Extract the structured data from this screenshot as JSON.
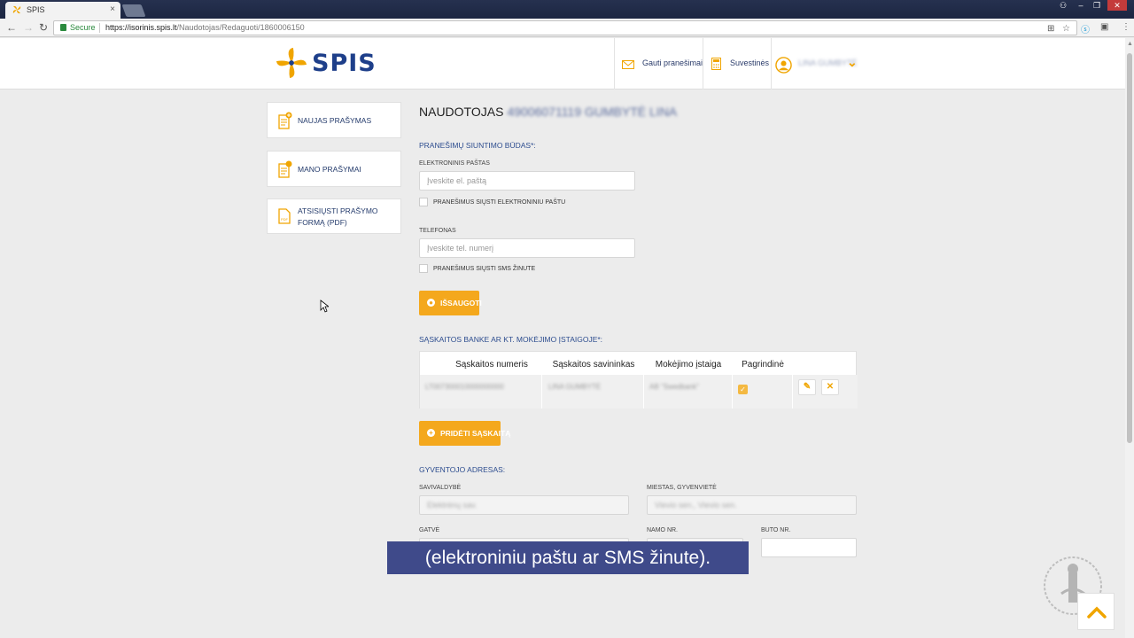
{
  "browser": {
    "tab_title": "SPIS",
    "tab_close": "×",
    "secure_label": "Secure",
    "url_host": "https://isorinis.spis.lt",
    "url_path": "/Naudotojas/Redaguoti/1860006150"
  },
  "header": {
    "logo_text": "SPIS",
    "notifications_label": "Gauti pranešimai",
    "summaries_label": "Suvestinės",
    "user_name": "LINA GUMBYTĖ"
  },
  "sidebar": {
    "items": [
      {
        "label": "NAUJAS PRAŠYMAS"
      },
      {
        "label": "MANO PRAŠYMAI"
      },
      {
        "label_line1": "ATSISIŲSTI PRAŠYMO",
        "label_line2": "FORMĄ (PDF)"
      }
    ]
  },
  "main": {
    "title": "NAUDOTOJAS",
    "title_user": "49006071119 GUMBYTĖ LINA",
    "notify_section": "PRANEŠIMŲ SIUNTIMO BŪDAS",
    "notify_section_suffix": "*:",
    "email_label": "ELEKTRONINIS PAŠTAS",
    "email_placeholder": "Įveskite el. paštą",
    "email_checkbox_label": "PRANEŠIMUS SIŲSTI ELEKTRONINIU PAŠTU",
    "phone_label": "TELEFONAS",
    "phone_placeholder": "Įveskite tel. numerį",
    "sms_checkbox_label": "PRANEŠIMUS SIŲSTI SMS ŽINUTE",
    "save_button": "IŠSAUGOTI",
    "accounts_section": "SĄSKAITOS BANKE AR KT. MOKĖJIMO ĮSTAIGOJE",
    "accounts_section_suffix": "*:",
    "table_headers": [
      "Sąskaitos numeris",
      "Sąskaitos savininkas",
      "Mokėjimo įstaiga",
      "Pagrindinė"
    ],
    "table_row": {
      "account_number": "LT007300010000000000",
      "owner": "LINA GUMBYTĖ",
      "institution": "AB \"Swedbank\"",
      "primary": true
    },
    "add_account_button": "PRIDĖTI SĄSKAITĄ",
    "address_section": "GYVENTOJO ADRESAS:",
    "municipality_label": "SAVIVALDYBĖ",
    "municipality_value": "Elektrėnų sav.",
    "city_label": "MIESTAS, GYVENVIETĖ",
    "city_value": "Vievio sen., Vievio sen.",
    "street_label": "GATVĖ",
    "house_label": "NAMO NR.",
    "flat_label": "BUTO NR."
  },
  "subtitle": "(elektroniniu paštu ar SMS žinute).",
  "colors": {
    "accent": "#f4a81d",
    "brand_blue": "#1e3f8a",
    "subtitle_bg": "#3f4a8a"
  }
}
